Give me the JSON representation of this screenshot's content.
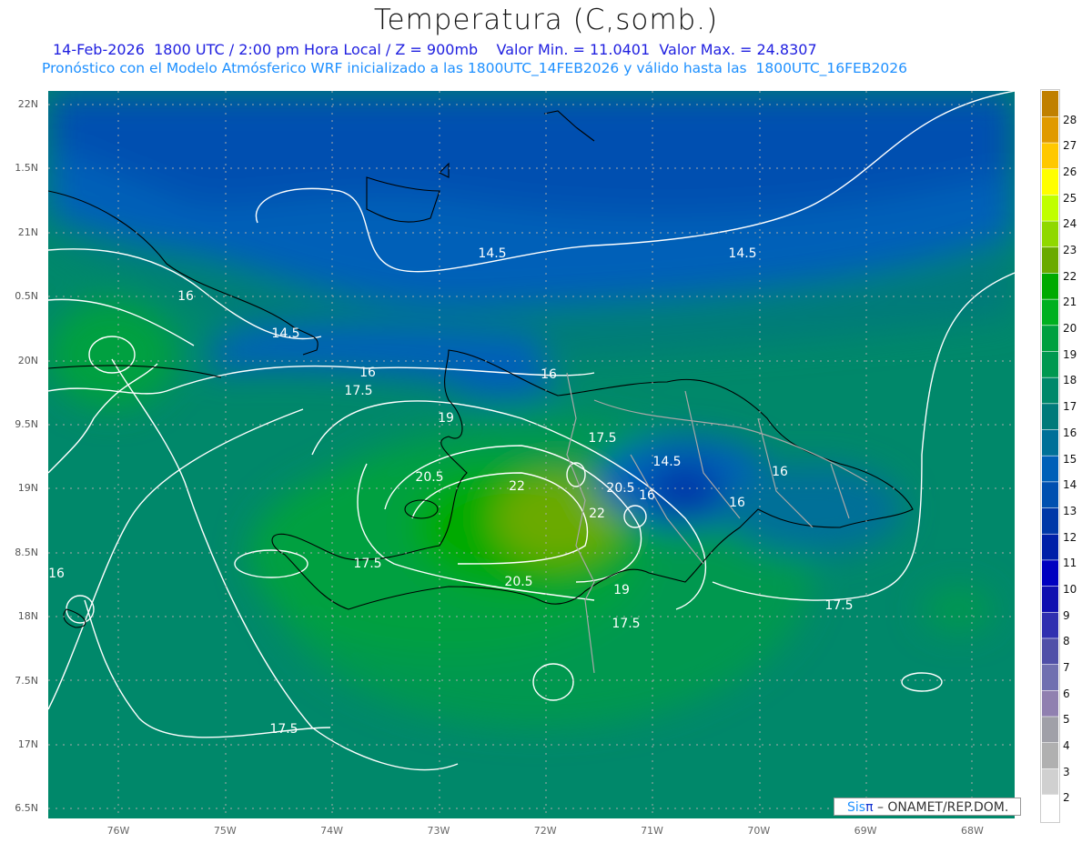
{
  "title": "Temperatura (C,somb.)",
  "subtitle": "14-Feb-2026  1800 UTC / 2:00 pm Hora Local / Z = 900mb    Valor Min. = 11.0401  Valor Max. = 24.8307",
  "forecast_line": "Pronóstico con el Modelo Atmósferico WRF inicializado a las 1800UTC_14FEB2026 y válido hasta las  1800UTC_16FEB2026",
  "lat_labels": [
    "22N",
    "1.5N",
    "21N",
    "0.5N",
    "20N",
    "9.5N",
    "19N",
    "8.5N",
    "18N",
    "7.5N",
    "17N",
    "6.5N"
  ],
  "lon_labels": [
    "76W",
    "75W",
    "74W",
    "73W",
    "72W",
    "71W",
    "70W",
    "69W",
    "68W"
  ],
  "colorbar": {
    "labels": [
      "28",
      "27",
      "26",
      "25",
      "24",
      "23",
      "22",
      "21",
      "20",
      "19",
      "18",
      "17",
      "16",
      "15",
      "14",
      "13",
      "12",
      "11",
      "10",
      "9",
      "8",
      "7",
      "6",
      "5",
      "4",
      "3",
      "2"
    ],
    "colors": [
      "#c08000",
      "#e09a00",
      "#ffc800",
      "#ffff00",
      "#c0ff00",
      "#90d800",
      "#6aaa00",
      "#00aa00",
      "#00b020",
      "#00a040",
      "#009850",
      "#00886a",
      "#007a7a",
      "#007098",
      "#0060b8",
      "#0050b0",
      "#0038a8",
      "#0020a8",
      "#0000c0",
      "#1010b0",
      "#3030b0",
      "#5050a8",
      "#7070b0",
      "#9080b0",
      "#a0a0a8",
      "#b0b0b0",
      "#d0d0d0",
      "#ffffff"
    ]
  },
  "contour_labels": [
    "14.5",
    "14.5",
    "16",
    "14.5",
    "16",
    "16",
    "17.5",
    "19",
    "17.5",
    "20.5",
    "22",
    "20.5",
    "16",
    "14.5",
    "16",
    "16",
    "22",
    "17.5",
    "20.5",
    "19",
    "17.5",
    "17.5",
    "16",
    "17.5"
  ],
  "logo": {
    "sis": "Sis",
    "pi": "π",
    "text": " – ONAMET/REP.DOM."
  }
}
